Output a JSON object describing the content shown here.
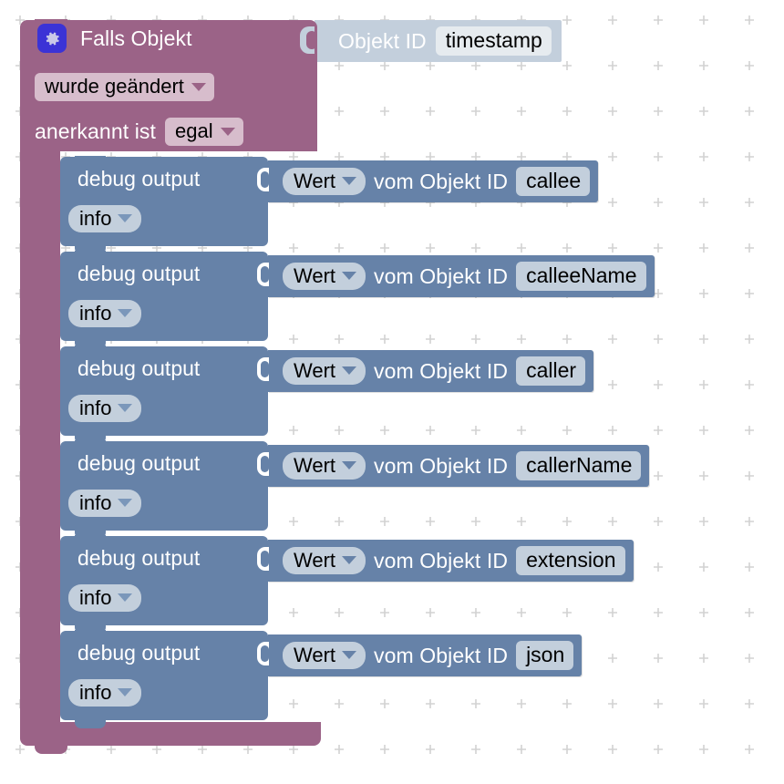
{
  "workspace": {
    "grid_spacing_px": 50,
    "grid_marker": "cross",
    "background_color": "#ffffff",
    "grid_color": "#d2d2d2"
  },
  "colors": {
    "event_block": "#9b6387",
    "event_field_pill": "#d7bdcc",
    "statement_block": "#6682a8",
    "value_block": "#6682a8",
    "value_field_pill": "#c3cfdc",
    "objid_block": "#c3cfdc",
    "objid_field_pill": "#e6ebef",
    "gear_badge": "#3b33d6",
    "block_text": "#ffffff",
    "field_text": "#000000"
  },
  "event_block": {
    "gear_icon": "gear-icon",
    "title": "Falls Objekt",
    "trigger_dropdown": "wurde geändert",
    "ack_label": "anerkannt ist",
    "ack_dropdown": "egal"
  },
  "object_id_value": {
    "label": "Objekt ID",
    "field": "timestamp"
  },
  "statements": [
    {
      "title": "debug output",
      "level": "info",
      "value": {
        "mode": "Wert",
        "label": "vom Objekt ID",
        "object_id": "callee"
      }
    },
    {
      "title": "debug output",
      "level": "info",
      "value": {
        "mode": "Wert",
        "label": "vom Objekt ID",
        "object_id": "calleeName"
      }
    },
    {
      "title": "debug output",
      "level": "info",
      "value": {
        "mode": "Wert",
        "label": "vom Objekt ID",
        "object_id": "caller"
      }
    },
    {
      "title": "debug output",
      "level": "info",
      "value": {
        "mode": "Wert",
        "label": "vom Objekt ID",
        "object_id": "callerName"
      }
    },
    {
      "title": "debug output",
      "level": "info",
      "value": {
        "mode": "Wert",
        "label": "vom Objekt ID",
        "object_id": "extension"
      }
    },
    {
      "title": "debug output",
      "level": "info",
      "value": {
        "mode": "Wert",
        "label": "vom Objekt ID",
        "object_id": "json"
      }
    }
  ]
}
